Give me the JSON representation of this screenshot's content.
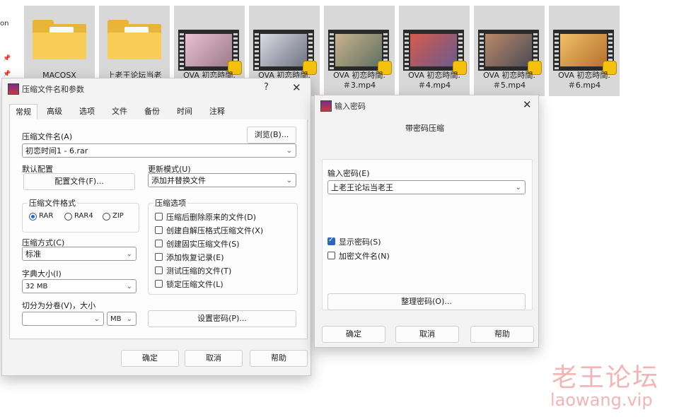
{
  "explorer": {
    "sidebar_label": "on",
    "items": [
      {
        "label": "MACOSX",
        "type": "folder"
      },
      {
        "label": "上老王论坛当老",
        "type": "folder"
      },
      {
        "label": "OVA 初恋時間.",
        "type": "video"
      },
      {
        "label": "OVA 初恋時間.",
        "type": "video"
      },
      {
        "label": "OVA 初恋時間.\n＃3.mp4",
        "type": "video"
      },
      {
        "label": "OVA 初恋時間.\n＃4.mp4",
        "type": "video"
      },
      {
        "label": "OVA 初恋時間.\n＃5.mp4",
        "type": "video"
      },
      {
        "label": "OVA 初恋時間.\n＃6.mp4",
        "type": "video"
      }
    ]
  },
  "archive_dialog": {
    "title": "压缩文件名和参数",
    "help": "?",
    "close": "✕",
    "tabs": [
      "常规",
      "高级",
      "选项",
      "文件",
      "备份",
      "时间",
      "注释"
    ],
    "active_tab": "常规",
    "archive_name_label": "压缩文件名(A)",
    "browse_button": "浏览(B)...",
    "archive_name_value": "初恋时间1 - 6.rar",
    "default_profile_label": "默认配置",
    "profiles_button": "配置文件(F)...",
    "update_mode_label": "更新模式(U)",
    "update_mode_value": "添加并替换文件",
    "format_group_label": "压缩文件格式",
    "formats": [
      {
        "label": "RAR",
        "selected": true
      },
      {
        "label": "RAR4",
        "selected": false
      },
      {
        "label": "ZIP",
        "selected": false
      }
    ],
    "options_group_label": "压缩选项",
    "options": [
      {
        "label": "压缩后删除原来的文件(D)",
        "checked": false
      },
      {
        "label": "创建自解压格式压缩文件(X)",
        "checked": false
      },
      {
        "label": "创建固实压缩文件(S)",
        "checked": false
      },
      {
        "label": "添加恢复记录(E)",
        "checked": false
      },
      {
        "label": "测试压缩的文件(T)",
        "checked": false
      },
      {
        "label": "锁定压缩文件(L)",
        "checked": false
      }
    ],
    "method_label": "压缩方式(C)",
    "method_value": "标准",
    "dict_label": "字典大小(I)",
    "dict_value": "32 MB",
    "split_label": "切分为分卷(V)，大小",
    "split_value": "",
    "split_unit": "MB",
    "set_password_button": "设置密码(P)...",
    "ok_button": "确定",
    "cancel_button": "取消",
    "help_button": "帮助"
  },
  "password_dialog": {
    "title": "输入密码",
    "close": "✕",
    "heading": "带密码压缩",
    "password_label": "输入密码(E)",
    "password_value": "上老王论坛当老王",
    "show_password_label": "显示密码(S)",
    "show_password_checked": true,
    "encrypt_names_label": "加密文件名(N)",
    "encrypt_names_checked": false,
    "organize_button": "整理密码(O)...",
    "ok_button": "确定",
    "cancel_button": "取消",
    "help_button": "帮助"
  },
  "watermark": {
    "line1": "老王论坛",
    "line2": "laowang.vip"
  }
}
